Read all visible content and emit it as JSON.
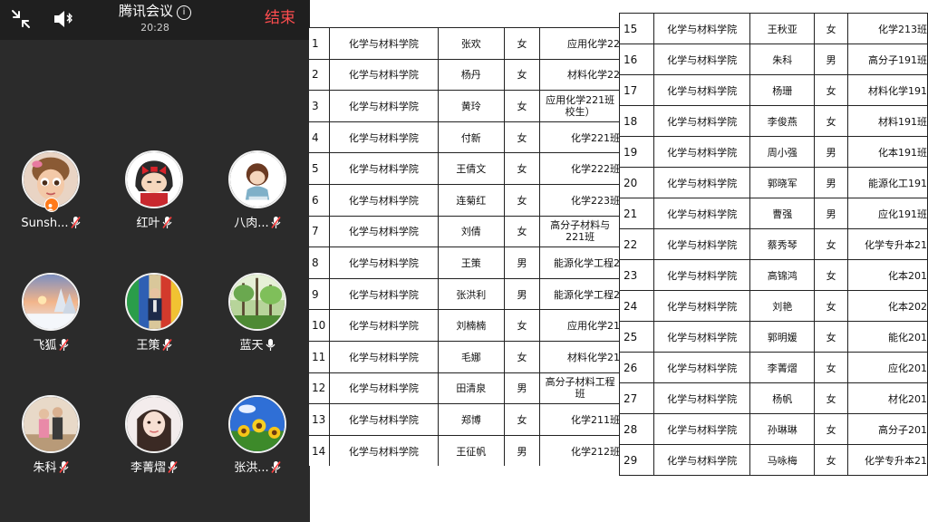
{
  "meeting": {
    "title": "腾讯会议",
    "time": "20:28",
    "end_label": "结束",
    "info_glyph": "i",
    "participants": [
      {
        "name": "Sunsh...",
        "avatar": "cartoon-girl-avatar",
        "mic": "muted",
        "badge": "host-icon"
      },
      {
        "name": "红叶",
        "avatar": "anime-girl-avatar",
        "mic": "muted"
      },
      {
        "name": "八肉...",
        "avatar": "anime-child-avatar",
        "mic": "muted"
      },
      {
        "name": "飞狐",
        "avatar": "snow-sunset-avatar",
        "mic": "muted"
      },
      {
        "name": "王策",
        "avatar": "person-flags-avatar",
        "mic": "muted"
      },
      {
        "name": "蓝天",
        "avatar": "forest-avatar",
        "mic": "active"
      },
      {
        "name": "朱科",
        "avatar": "family-photo-avatar",
        "mic": "muted"
      },
      {
        "name": "李菁熠",
        "avatar": "girl-photo-avatar",
        "mic": "muted"
      },
      {
        "name": "张洪...",
        "avatar": "sunflower-avatar",
        "mic": "muted"
      }
    ]
  },
  "table_left": {
    "rows": [
      {
        "no": "1",
        "college": "化学与材料学院",
        "name": "张欢",
        "gender": "女",
        "class": "应用化学22"
      },
      {
        "no": "2",
        "college": "化学与材料学院",
        "name": "杨丹",
        "gender": "女",
        "class": "材料化学22"
      },
      {
        "no": "3",
        "college": "化学与材料学院",
        "name": "黄玲",
        "gender": "女",
        "class": "应用化学221班\n校生）"
      },
      {
        "no": "4",
        "college": "化学与材料学院",
        "name": "付新",
        "gender": "女",
        "class": "化学221班"
      },
      {
        "no": "5",
        "college": "化学与材料学院",
        "name": "王倩文",
        "gender": "女",
        "class": "化学222班"
      },
      {
        "no": "6",
        "college": "化学与材料学院",
        "name": "连菊红",
        "gender": "女",
        "class": "化学223班"
      },
      {
        "no": "7",
        "college": "化学与材料学院",
        "name": "刘倩",
        "gender": "女",
        "class": "高分子材料与\n221班"
      },
      {
        "no": "8",
        "college": "化学与材料学院",
        "name": "王策",
        "gender": "男",
        "class": "能源化学工程2"
      },
      {
        "no": "9",
        "college": "化学与材料学院",
        "name": "张洪利",
        "gender": "男",
        "class": "能源化学工程2"
      },
      {
        "no": "10",
        "college": "化学与材料学院",
        "name": "刘楠楠",
        "gender": "女",
        "class": "应用化学21"
      },
      {
        "no": "11",
        "college": "化学与材料学院",
        "name": "毛娜",
        "gender": "女",
        "class": "材料化学21"
      },
      {
        "no": "12",
        "college": "化学与材料学院",
        "name": "田清泉",
        "gender": "男",
        "class": "高分子材料工程\n班"
      },
      {
        "no": "13",
        "college": "化学与材料学院",
        "name": "郑博",
        "gender": "女",
        "class": "化学211班"
      },
      {
        "no": "14",
        "college": "化学与材料学院",
        "name": "王征帆",
        "gender": "男",
        "class": "化学212班"
      }
    ]
  },
  "table_right": {
    "rows": [
      {
        "no": "15",
        "college": "化学与材料学院",
        "name": "王秋亚",
        "gender": "女",
        "class": "化学213班"
      },
      {
        "no": "16",
        "college": "化学与材料学院",
        "name": "朱科",
        "gender": "男",
        "class": "高分子191班"
      },
      {
        "no": "17",
        "college": "化学与材料学院",
        "name": "杨珊",
        "gender": "女",
        "class": "材料化学191"
      },
      {
        "no": "18",
        "college": "化学与材料学院",
        "name": "李俊燕",
        "gender": "女",
        "class": "材料191班"
      },
      {
        "no": "19",
        "college": "化学与材料学院",
        "name": "周小强",
        "gender": "男",
        "class": "化本191班"
      },
      {
        "no": "20",
        "college": "化学与材料学院",
        "name": "郭晓军",
        "gender": "男",
        "class": "能源化工191"
      },
      {
        "no": "21",
        "college": "化学与材料学院",
        "name": "曹强",
        "gender": "男",
        "class": "应化191班"
      },
      {
        "no": "22",
        "college": "化学与材料学院",
        "name": "蔡秀琴",
        "gender": "女",
        "class": "化学专升本21"
      },
      {
        "no": "23",
        "college": "化学与材料学院",
        "name": "高锦鸿",
        "gender": "女",
        "class": "化本201"
      },
      {
        "no": "24",
        "college": "化学与材料学院",
        "name": "刘艳",
        "gender": "女",
        "class": "化本202"
      },
      {
        "no": "25",
        "college": "化学与材料学院",
        "name": "郭明媛",
        "gender": "女",
        "class": "能化201"
      },
      {
        "no": "26",
        "college": "化学与材料学院",
        "name": "李菁熠",
        "gender": "女",
        "class": "应化201"
      },
      {
        "no": "27",
        "college": "化学与材料学院",
        "name": "杨帆",
        "gender": "女",
        "class": "材化201"
      },
      {
        "no": "28",
        "college": "化学与材料学院",
        "name": "孙琳琳",
        "gender": "女",
        "class": "高分子201"
      },
      {
        "no": "29",
        "college": "化学与材料学院",
        "name": "马咏梅",
        "gender": "女",
        "class": "化学专升本21"
      }
    ]
  }
}
